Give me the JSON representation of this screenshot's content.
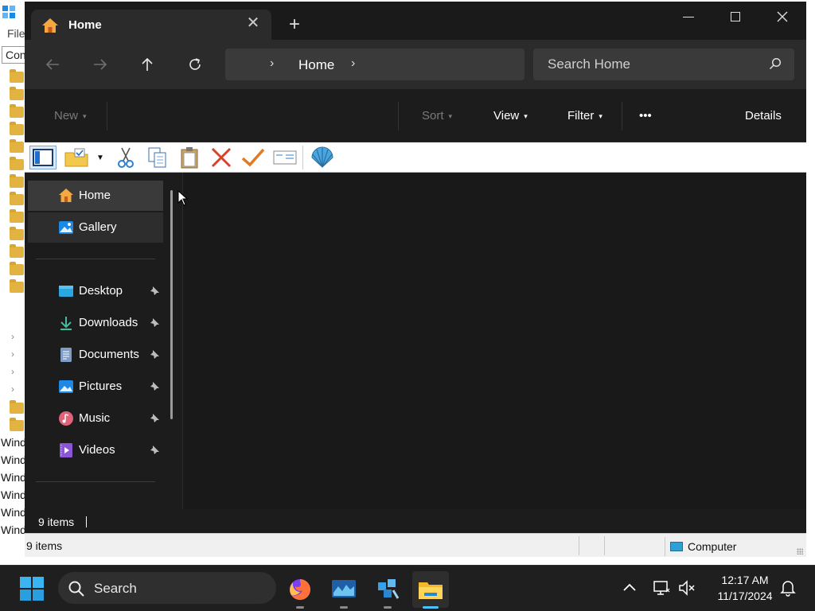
{
  "background_window": {
    "menu_label": "File",
    "address_stub": "Con",
    "tree_item_label": "Wind",
    "status_text": "9 items",
    "zone_label": "Computer"
  },
  "explorer": {
    "tab": {
      "title": "Home",
      "close_glyph": "✕"
    },
    "new_tab_glyph": "+",
    "address": {
      "crumb": "Home"
    },
    "search": {
      "placeholder": "Search Home"
    },
    "command_bar": {
      "new_label": "New",
      "sort_label": "Sort",
      "view_label": "View",
      "filter_label": "Filter",
      "more_label": "•••",
      "details_label": "Details"
    },
    "nav": {
      "home": "Home",
      "gallery": "Gallery",
      "pinned": [
        {
          "label": "Desktop",
          "icon": "desktop-icon"
        },
        {
          "label": "Downloads",
          "icon": "download-icon"
        },
        {
          "label": "Documents",
          "icon": "documents-icon"
        },
        {
          "label": "Pictures",
          "icon": "pictures-icon"
        },
        {
          "label": "Music",
          "icon": "music-icon"
        },
        {
          "label": "Videos",
          "icon": "videos-icon"
        }
      ]
    },
    "status": {
      "items_text": "9 items"
    }
  },
  "taskbar": {
    "search_label": "Search",
    "clock": {
      "time": "12:17 AM",
      "date": "11/17/2024"
    },
    "apps": [
      "firefox-icon",
      "monitor-app-icon",
      "tool-app-icon",
      "file-explorer-icon"
    ]
  },
  "colors": {
    "accent": "#4cc2ff",
    "explorer_bg": "#1c1c1c",
    "folder": "#e3b341"
  }
}
